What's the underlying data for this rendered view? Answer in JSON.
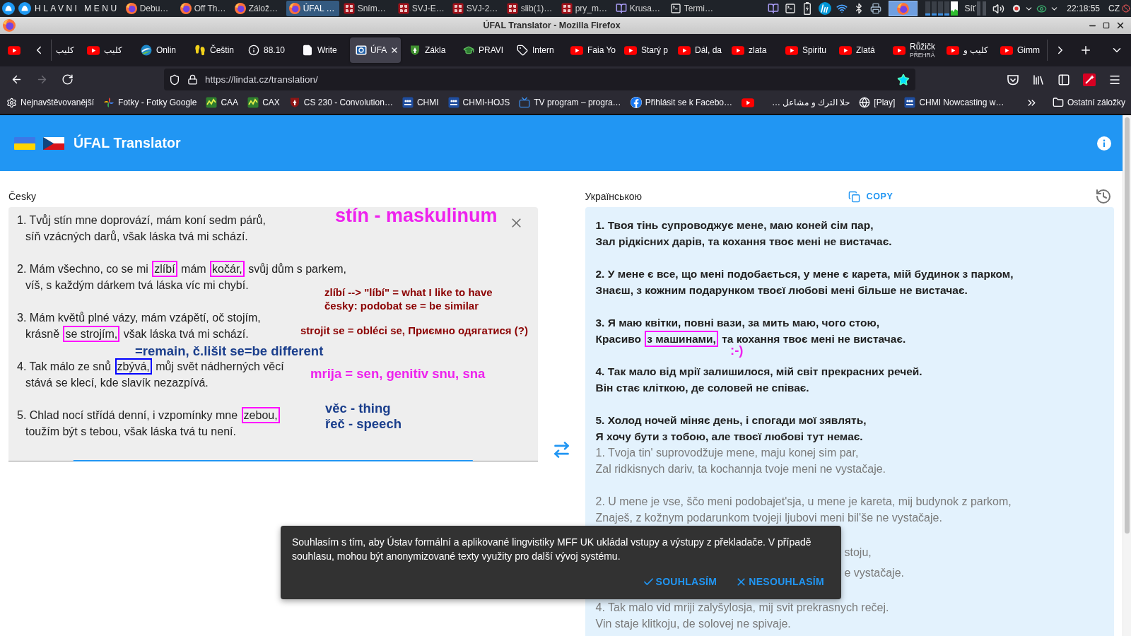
{
  "taskbar": {
    "menu_label": "HLAVNI MENU",
    "tasks": [
      {
        "label": "Debu…",
        "kind": "firefox",
        "selected": false
      },
      {
        "label": "Off Th…",
        "kind": "firefox",
        "selected": false
      },
      {
        "label": "Zálož…",
        "kind": "firefox",
        "selected": false
      },
      {
        "label": "ÚFAL …",
        "kind": "firefox",
        "selected": true
      },
      {
        "label": "Sním…",
        "kind": "image",
        "selected": false
      },
      {
        "label": "SVJ-E…",
        "kind": "image",
        "selected": false
      },
      {
        "label": "SVJ-2…",
        "kind": "image",
        "selected": false
      },
      {
        "label": "slib(1)…",
        "kind": "image",
        "selected": false
      },
      {
        "label": "pry_m…",
        "kind": "image",
        "selected": false
      },
      {
        "label": "Krusa…",
        "kind": "reader",
        "selected": false
      },
      {
        "label": "Termi…",
        "kind": "terminal",
        "selected": false
      }
    ],
    "network_label": "Síť",
    "clock": "22:18:55",
    "keyboard_layout": "CZ"
  },
  "window": {
    "title": "ÚFAL Translator - Mozilla Firefox"
  },
  "browser": {
    "tabs": [
      {
        "kind": "youtube",
        "pinned": true,
        "selected": false
      },
      {
        "label": "كليب",
        "kind": "partial",
        "pinned": false,
        "selected": false
      },
      {
        "label": "كليب",
        "kind": "youtube",
        "pinned": false,
        "selected": false
      },
      {
        "label": "Onlin",
        "kind": "sphere",
        "pinned": false,
        "selected": false
      },
      {
        "label": "Češtin",
        "kind": "feet",
        "pinned": false,
        "selected": false
      },
      {
        "label": "88.10",
        "kind": "info",
        "pinned": false,
        "selected": false
      },
      {
        "label": "Write",
        "kind": "page",
        "pinned": false,
        "selected": false
      },
      {
        "label": "ÚFA",
        "kind": "ufal",
        "pinned": false,
        "selected": true
      },
      {
        "label": "Zákla",
        "kind": "crest",
        "pinned": false,
        "selected": false
      },
      {
        "label": "PRAVI",
        "kind": "cap",
        "pinned": false,
        "selected": false
      },
      {
        "label": "Intern",
        "kind": "tag",
        "pinned": false,
        "selected": false
      },
      {
        "label": "Faia Yo",
        "kind": "youtube",
        "pinned": false,
        "selected": false
      },
      {
        "label": "Starý p",
        "kind": "youtube",
        "pinned": false,
        "selected": false
      },
      {
        "label": "Dál, da",
        "kind": "youtube",
        "pinned": false,
        "selected": false
      },
      {
        "label": "zlata",
        "kind": "youtube",
        "pinned": false,
        "selected": false
      },
      {
        "label": "Spiritu",
        "kind": "youtube",
        "pinned": false,
        "selected": false
      },
      {
        "label": "Zlatá",
        "kind": "youtube",
        "pinned": false,
        "selected": false
      },
      {
        "label": "Růžičk",
        "status": "PŘEHRÁ",
        "kind": "youtube",
        "pinned": false,
        "selected": false
      },
      {
        "label": "كليب و",
        "kind": "youtube",
        "pinned": false,
        "selected": false
      },
      {
        "label": "Gimm",
        "kind": "youtube",
        "pinned": false,
        "selected": false
      }
    ],
    "nav_buttons": [
      {
        "kind": "back",
        "disabled": false
      },
      {
        "kind": "forward",
        "disabled": true
      },
      {
        "kind": "reload",
        "disabled": false
      }
    ],
    "url": "https://lindat.cz/translation/",
    "bookmarked": true,
    "bookmarks": [
      {
        "label": "Nejnavštěvovanější",
        "kind": "gear"
      },
      {
        "label": "Fotky - Fotky Google",
        "kind": "pinwheel"
      },
      {
        "label": "CAA",
        "kind": "chart"
      },
      {
        "label": "CAX",
        "kind": "chart"
      },
      {
        "label": "CS 230 - Convolution…",
        "kind": "crest"
      },
      {
        "label": "CHMI",
        "kind": "chmi"
      },
      {
        "label": "CHMI-HOJS",
        "kind": "chmi"
      },
      {
        "label": "TV program – progra…",
        "kind": "tv"
      },
      {
        "label": "Přihlásit se k Facebo…",
        "kind": "facebook"
      },
      {
        "kind": "youtube"
      },
      {
        "label": "حلا الترك و مشاعل …",
        "kind": "none"
      },
      {
        "label": "[Play]",
        "kind": "globe"
      },
      {
        "label": "CHMI Nowcasting w…",
        "kind": "chmi"
      }
    ],
    "other_bookmarks": "Ostatní záložky"
  },
  "page": {
    "title": "ÚFAL Translator",
    "source": {
      "label": "Česky",
      "focused": true,
      "stanzas": [
        [
          [
            {
              "kind": "plain",
              "text": "1. Tvůj stín mne doprovází, mám koní sedm párů,"
            }
          ],
          [
            {
              "kind": "plain",
              "text": "síň vzácných darů, však láska tvá mi schází."
            }
          ]
        ],
        [
          [
            {
              "kind": "plain",
              "text": "2. Mám všechno, co se mi "
            },
            {
              "kind": "boxed",
              "text": "zlíbí",
              "color": "#ff00ff"
            },
            {
              "kind": "plain",
              "text": " mám "
            },
            {
              "kind": "boxed",
              "text": "kočár,",
              "color": "#ff00ff"
            },
            {
              "kind": "plain",
              "text": " svůj dům s parkem,"
            }
          ],
          [
            {
              "kind": "plain",
              "text": "víš, s každým dárkem tvá láska víc mi chybí."
            }
          ]
        ],
        [
          [
            {
              "kind": "plain",
              "text": "3. Mám květů plné vázy, mám vzápětí, oč stojím,"
            }
          ],
          [
            {
              "kind": "plain",
              "text": "krásně "
            },
            {
              "kind": "boxed",
              "text": "se strojím,",
              "color": "#ff00ff"
            },
            {
              "kind": "plain",
              "text": " však láska tvá mi schází."
            }
          ]
        ],
        [
          [
            {
              "kind": "plain",
              "text": "4. Tak málo ze snů "
            },
            {
              "kind": "boxed",
              "text": "zbývá,",
              "color": "#0000ff"
            },
            {
              "kind": "plain",
              "text": " můj svět nádherných věcí"
            }
          ],
          [
            {
              "kind": "plain",
              "text": "stává se klecí, kde slavík nezazpívá."
            }
          ]
        ],
        [
          [
            {
              "kind": "plain",
              "text": "5. Chlad nocí střídá denní, i vzpomínky mne "
            },
            {
              "kind": "boxed",
              "text": "zebou,",
              "color": "#ff00ff"
            }
          ],
          [
            {
              "kind": "plain",
              "text": "toužím být s tebou, však láska tvá tu není."
            }
          ]
        ]
      ],
      "annotations": [
        {
          "text": "stín - maskulinum",
          "kind": "heading",
          "color": "#ee22ee"
        },
        {
          "text": "zlíbí --> \"líbí\" = what I like to have",
          "kind": "comment",
          "color": "#8b0000"
        },
        {
          "text": "česky: podobat se = be similar",
          "kind": "comment",
          "color": "#8b0000"
        },
        {
          "text": "strojit se = obléci se, Приємно одягатися (?)",
          "kind": "comment",
          "color": "#8b0000"
        },
        {
          "text": "=remain, č.lišit se=be different",
          "kind": "note",
          "color": "#1a3e8c"
        },
        {
          "text": "mrija = sen, genitiv snu, sna",
          "kind": "note",
          "color": "#ee22ee"
        },
        {
          "text": "věc - thing",
          "kind": "note",
          "color": "#1a3e8c"
        },
        {
          "text": "řeč - speech",
          "kind": "note",
          "color": "#1a3e8c"
        }
      ]
    },
    "translation": {
      "label": "Українською",
      "copy_label": "COPY",
      "stanzas": [
        [
          [
            {
              "kind": "plain",
              "text": "1. Твоя тінь супроводжує мене, маю коней сім пар,"
            }
          ],
          [
            {
              "kind": "plain",
              "text": "Зал рідкісних дарів, та кохання твоє мені не вистачає."
            }
          ]
        ],
        [
          [
            {
              "kind": "plain",
              "text": "2. У мене є все, що мені подобається, у мене є карета, мій будинок з парком,"
            }
          ],
          [
            {
              "kind": "plain",
              "text": "Знаєш, з кожним подарунком твоєї любові мені більше не вистачає."
            }
          ]
        ],
        [
          [
            {
              "kind": "plain",
              "text": "3. Я маю квітки, повні вази, за мить маю, чого стою,"
            }
          ],
          [
            {
              "kind": "plain",
              "text": "Красиво "
            },
            {
              "kind": "boxed",
              "text": "з машинами,",
              "color": "#ff00ff"
            },
            {
              "kind": "plain",
              "text": " та кохання твоє мені не вистачає."
            }
          ]
        ],
        [
          [
            {
              "kind": "plain",
              "text": "4. Так мало від мрії залишилося, мій світ прекрасних речей."
            }
          ],
          [
            {
              "kind": "plain",
              "text": "Він стає кліткою, де соловей не співає."
            }
          ]
        ],
        [
          [
            {
              "kind": "plain",
              "text": "5. Холод ночей міняє день, і спогади мої зявлять,"
            }
          ],
          [
            {
              "kind": "plain",
              "text": "Я хочу бути з тобою, але твоєї любові тут немає."
            }
          ]
        ]
      ],
      "annotations": [
        {
          "text": ":-)",
          "kind": "note",
          "color": "#ee22ee"
        }
      ],
      "transliteration": [
        [
          {
            "text": "1. Tvoja tin' suprovodžuje mene, maju konej sim par,",
            "covered": false
          },
          {
            "text": "Zal ridkisnych dariv, ta kochannja tvoje meni ne vystačaje.",
            "covered": false
          }
        ],
        [
          {
            "text": "2. U mene je vse, ščo meni podobajet'sja, u mene je kareta, mij budynok z parkom,",
            "covered": false
          },
          {
            "text": "Znaješ, z kožnym podarunkom tvojeji ljubovi meni bil'še ne vystačaje.",
            "covered": false
          }
        ],
        [
          {
            "text": "stoju,",
            "covered": true
          },
          {
            "text": "e vystačaje.",
            "covered": true
          }
        ],
        [
          {
            "text": "4. Tak malo vid mriji zalyšylosja, mij svit prekrasnych rečej.",
            "covered": false
          },
          {
            "text": "Vin staje klitkoju, de solovej ne spivaje.",
            "covered": false
          }
        ]
      ]
    },
    "consent": {
      "text": "Souhlasím s tím, aby Ústav formální a aplikované lingvistiky MFF UK ukládal vstupy a výstupy z překladače. V případě souhlasu, mohou být anonymizované texty využity pro další vývoj systému.",
      "buttons": [
        {
          "label": "SOUHLASÍM",
          "kind": "accept"
        },
        {
          "label": "NESOUHLASÍM",
          "kind": "decline"
        }
      ]
    }
  }
}
